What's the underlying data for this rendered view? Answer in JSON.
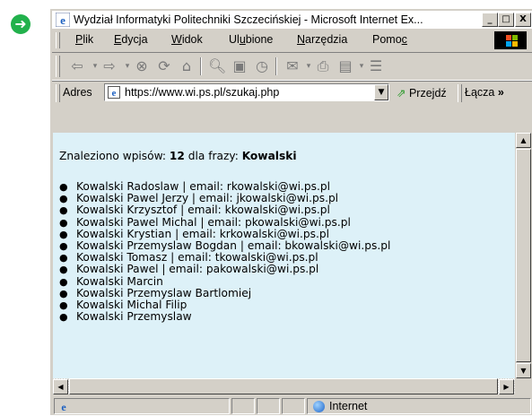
{
  "window": {
    "title": "Wydział Informatyki Politechniki Szczecińskiej - Microsoft Internet Ex...",
    "controls": {
      "minimize": "_",
      "maximize": "□",
      "close": "X"
    }
  },
  "menu": [
    {
      "label": "Plik"
    },
    {
      "label": "Edycja"
    },
    {
      "label": "Widok"
    },
    {
      "label": "Ulubione"
    },
    {
      "label": "Narzędzia"
    },
    {
      "label": "Pomoc"
    }
  ],
  "toolbar": {
    "icons": [
      "back-icon",
      "forward-icon",
      "stop-icon",
      "refresh-icon",
      "home-icon",
      "search-icon",
      "favorites-icon",
      "history-icon",
      "mail-icon",
      "print-icon",
      "edit-icon",
      "discuss-icon"
    ]
  },
  "address": {
    "label": "Adres",
    "url": "https://www.wi.ps.pl/szukaj.php",
    "go": "Przejdź",
    "links": "Łącza"
  },
  "content": {
    "found_prefix": "Znaleziono wpisów:",
    "count": "12",
    "phrase_label": "dla frazy:",
    "phrase": "Kowalski",
    "results": [
      "Kowalski Radoslaw | email: rkowalski@wi.ps.pl",
      "Kowalski Pawel Jerzy | email: jkowalski@wi.ps.pl",
      "Kowalski Krzysztof | email: kkowalski@wi.ps.pl",
      "Kowalski Pawel Michal | email: pkowalski@wi.ps.pl",
      "Kowalski Krystian | email: krkowalski@wi.ps.pl",
      "Kowalski Przemyslaw Bogdan | email: bkowalski@wi.ps.pl",
      "Kowalski Tomasz | email: tkowalski@wi.ps.pl",
      "Kowalski Pawel | email: pakowalski@wi.ps.pl",
      "Kowalski Marcin",
      "Kowalski Przemyslaw Bartlomiej",
      "Kowalski Michal Filip",
      "Kowalski Przemyslaw"
    ]
  },
  "status": {
    "zone": "Internet"
  },
  "colors": {
    "content_bg": "#ddf1f8",
    "chrome": "#d4d0c8",
    "arrow": "#22b14c"
  }
}
